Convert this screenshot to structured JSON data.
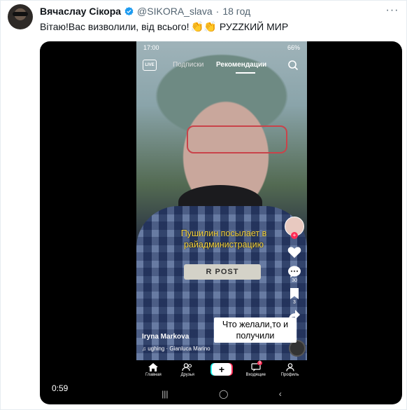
{
  "tweet": {
    "author_name": "Вячаслау Сікора",
    "handle": "@SIKORA_slava",
    "time": "18 год",
    "text": "Вітаю!Вас визволили, від всього!",
    "text_suffix": "РУZZКИЙ МИР",
    "emoji": "👏👏"
  },
  "video": {
    "duration": "0:59",
    "overlay_text": "Что желали,то и получили",
    "phone": {
      "status_time": "17:00",
      "battery": "66%",
      "tabs": [
        "Подписки",
        "Рекомендации"
      ],
      "caption": "Пушилин посылает в райадминистрацию",
      "badge_text": "R  POST",
      "author": "Iryna Markova",
      "music": "♫  ughing · Gianluca Marino",
      "comments_count": "30",
      "saves_count": "3",
      "bottom_nav": [
        "Главная",
        "Друзья",
        "",
        "Входящие",
        "Профиль"
      ],
      "inbox_badge": "9"
    }
  },
  "colors": {
    "verified": "#1d9bf0",
    "caption_yellow": "#f4d13a",
    "tiktok_red": "#fe2c55"
  }
}
